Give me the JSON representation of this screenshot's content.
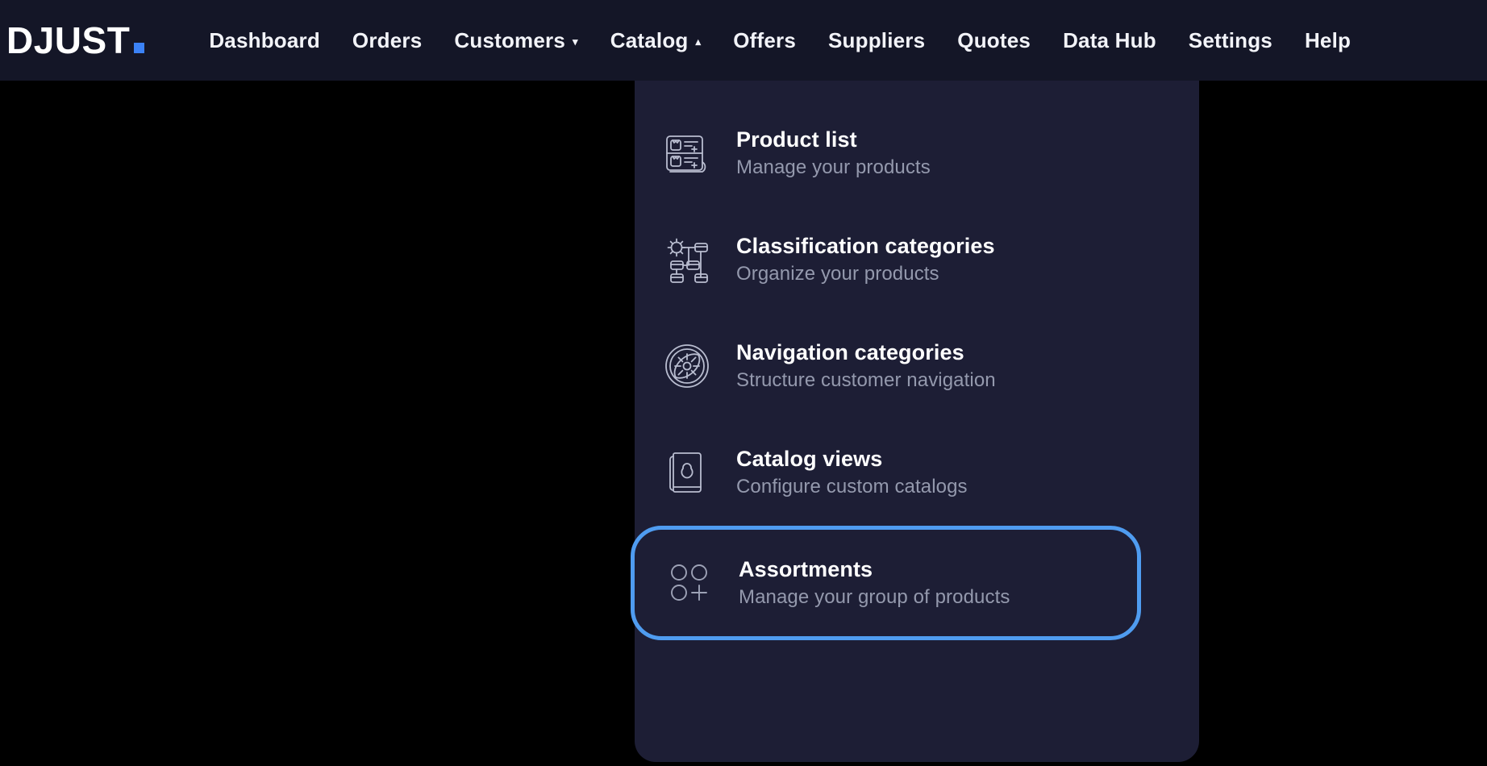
{
  "brand": {
    "name": "DJUST",
    "dot": ".",
    "accent": "#3b82f6"
  },
  "topnav": {
    "items": [
      {
        "label": "Dashboard",
        "caret": "",
        "name": "dashboard"
      },
      {
        "label": "Orders",
        "caret": "",
        "name": "orders"
      },
      {
        "label": "Customers",
        "caret": "▾",
        "name": "customers"
      },
      {
        "label": "Catalog",
        "caret": "▴",
        "name": "catalog"
      },
      {
        "label": "Offers",
        "caret": "",
        "name": "offers"
      },
      {
        "label": "Suppliers",
        "caret": "",
        "name": "suppliers"
      },
      {
        "label": "Quotes",
        "caret": "",
        "name": "quotes"
      },
      {
        "label": "Data Hub",
        "caret": "",
        "name": "data-hub"
      },
      {
        "label": "Settings",
        "caret": "",
        "name": "settings"
      },
      {
        "label": "Help",
        "caret": "",
        "name": "help"
      }
    ]
  },
  "dropdown": {
    "owner": "Catalog",
    "highlight_color": "#4f9cf0",
    "background": "#1d1e35",
    "items": [
      {
        "title": "Product list",
        "subtitle": "Manage your products",
        "icon": "product-list-icon",
        "highlighted": false
      },
      {
        "title": "Classification categories",
        "subtitle": "Organize your products",
        "icon": "classification-categories-icon",
        "highlighted": false
      },
      {
        "title": "Navigation categories",
        "subtitle": "Structure customer navigation",
        "icon": "navigation-categories-icon",
        "highlighted": false
      },
      {
        "title": "Catalog views",
        "subtitle": "Configure custom catalogs",
        "icon": "catalog-views-icon",
        "highlighted": false
      },
      {
        "title": "Assortments",
        "subtitle": "Manage your group of products",
        "icon": "assortments-icon",
        "highlighted": true
      }
    ]
  }
}
